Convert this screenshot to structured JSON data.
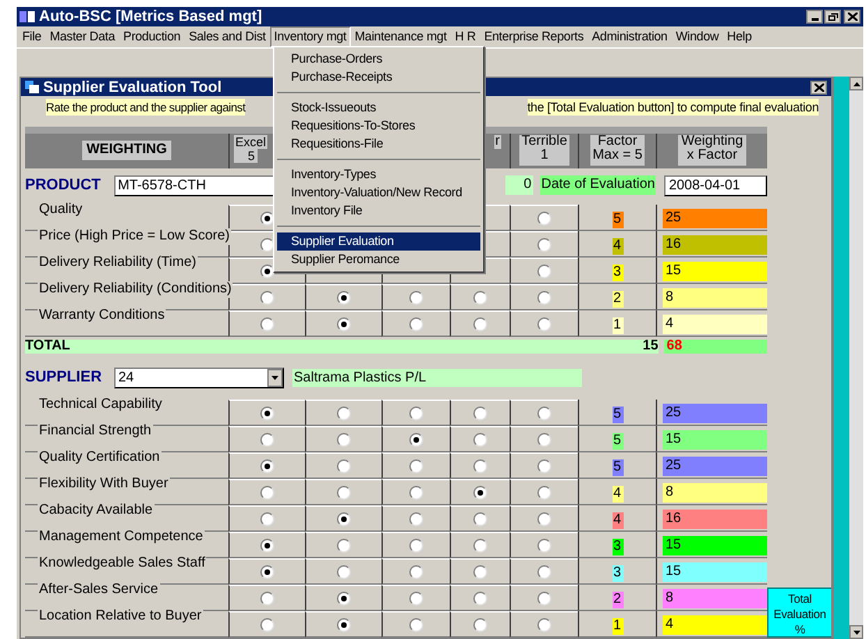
{
  "window": {
    "title": "Auto-BSC [Metrics Based mgt]"
  },
  "menu": [
    {
      "label": "File",
      "selected": false
    },
    {
      "label": "Master Data",
      "selected": false
    },
    {
      "label": "Production",
      "selected": false
    },
    {
      "label": "Sales and Dist",
      "selected": false
    },
    {
      "label": "Inventory mgt",
      "selected": true
    },
    {
      "label": "Maintenance mgt",
      "selected": false
    },
    {
      "label": "H R",
      "selected": false
    },
    {
      "label": "Enterprise Reports",
      "selected": false
    },
    {
      "label": "Administration",
      "selected": false
    },
    {
      "label": "Window",
      "selected": false
    },
    {
      "label": "Help",
      "selected": false
    }
  ],
  "dropdown": {
    "sections": [
      {
        "items": [
          {
            "label": "Purchase-Orders",
            "selected": false
          },
          {
            "label": "Purchase-Receipts",
            "selected": false
          }
        ]
      },
      {
        "items": [
          {
            "label": "Stock-Issueouts",
            "selected": false
          },
          {
            "label": "Requesitions-To-Stores",
            "selected": false
          },
          {
            "label": "Requesitions-File",
            "selected": false
          }
        ]
      },
      {
        "items": [
          {
            "label": "Inventory-Types",
            "selected": false
          },
          {
            "label": "Inventory-Valuation/New Record",
            "selected": false
          },
          {
            "label": "Inventory File",
            "selected": false
          }
        ]
      },
      {
        "items": [
          {
            "label": "Supplier Evaluation",
            "selected": true
          },
          {
            "label": "Supplier Peromance",
            "selected": false
          }
        ]
      }
    ]
  },
  "tool": {
    "title": "Supplier Evaluation Tool",
    "instruction_left": "Rate the product and the supplier against",
    "instruction_right": "the [Total Evaluation button] to compute final evaluation"
  },
  "header": {
    "weighting_button": "WEIGHTING",
    "excellent": {
      "label": "Excel",
      "score": "5"
    },
    "column_4": "r",
    "terrible": {
      "label": "Terrible",
      "score": "1"
    },
    "factor": [
      "Factor",
      "Max = 5"
    ],
    "weighting_x_factor": [
      "Weighting",
      "x Factor"
    ]
  },
  "product": {
    "label": "PRODUCT",
    "value": "MT-6578-CTH",
    "name": "0",
    "date_label": "Date of Evaluation",
    "date": "2008-04-01"
  },
  "product_criteria": [
    {
      "name": "Quality",
      "choices": [
        {
          "selected": true
        },
        {
          "selected": false
        }
      ],
      "factor": "5",
      "weight": "25",
      "color": "#ff8000"
    },
    {
      "name": "Price (High Price = Low Score)",
      "choices": [
        {
          "selected": false
        },
        {
          "selected": false
        }
      ],
      "factor": "4",
      "weight": "16",
      "color": "#c0c000"
    },
    {
      "name": "Delivery Reliability (Time)",
      "choices": [
        {
          "selected": true
        },
        {
          "selected": false
        }
      ],
      "factor": "3",
      "weight": "15",
      "color": "#ffff00"
    },
    {
      "name": "Delivery Reliability (Conditions)",
      "choices": [
        {
          "selected": false
        },
        {
          "selected": true
        },
        {
          "selected": false
        },
        {
          "selected": false
        },
        {
          "selected": false
        }
      ],
      "factor": "2",
      "weight": "8",
      "color": "#ffff80"
    },
    {
      "name": "Warranty Conditions",
      "choices": [
        {
          "selected": false
        },
        {
          "selected": true
        },
        {
          "selected": false
        },
        {
          "selected": false
        },
        {
          "selected": false
        }
      ],
      "factor": "1",
      "weight": "4",
      "color": "#ffffc0"
    }
  ],
  "total": {
    "label": "TOTAL",
    "factor": "15",
    "weight": "68"
  },
  "supplier": {
    "label": "SUPPLIER",
    "value": "24",
    "name": "Saltrama Plastics P/L"
  },
  "supplier_criteria": [
    {
      "name": "Technical Capability",
      "choices": [
        {
          "selected": true
        },
        {
          "selected": false
        },
        {
          "selected": false
        },
        {
          "selected": false
        },
        {
          "selected": false
        }
      ],
      "factor": "5",
      "weight": "25",
      "color": "#8080ff"
    },
    {
      "name": "Financial Strength",
      "choices": [
        {
          "selected": false
        },
        {
          "selected": false
        },
        {
          "selected": true
        },
        {
          "selected": false
        },
        {
          "selected": false
        }
      ],
      "factor": "5",
      "weight": "15",
      "color": "#80ff80"
    },
    {
      "name": "Quality Certification",
      "choices": [
        {
          "selected": true
        },
        {
          "selected": false
        },
        {
          "selected": false
        },
        {
          "selected": false
        },
        {
          "selected": false
        }
      ],
      "factor": "5",
      "weight": "25",
      "color": "#8080ff"
    },
    {
      "name": "Flexibility With Buyer",
      "choices": [
        {
          "selected": false
        },
        {
          "selected": false
        },
        {
          "selected": false
        },
        {
          "selected": true
        },
        {
          "selected": false
        }
      ],
      "factor": "4",
      "weight": "8",
      "color": "#ffff80"
    },
    {
      "name": "Cabacity Available",
      "choices": [
        {
          "selected": false
        },
        {
          "selected": true
        },
        {
          "selected": false
        },
        {
          "selected": false
        },
        {
          "selected": false
        }
      ],
      "factor": "4",
      "weight": "16",
      "color": "#ff8080"
    },
    {
      "name": "Management Competence",
      "choices": [
        {
          "selected": true
        },
        {
          "selected": false
        },
        {
          "selected": false
        },
        {
          "selected": false
        },
        {
          "selected": false
        }
      ],
      "factor": "3",
      "weight": "15",
      "color": "#00ff00"
    },
    {
      "name": "Knowledgeable Sales Staff",
      "choices": [
        {
          "selected": true
        },
        {
          "selected": false
        },
        {
          "selected": false
        },
        {
          "selected": false
        },
        {
          "selected": false
        }
      ],
      "factor": "3",
      "weight": "15",
      "color": "#80ffff"
    },
    {
      "name": "After-Sales Service",
      "choices": [
        {
          "selected": false
        },
        {
          "selected": true
        },
        {
          "selected": false
        },
        {
          "selected": false
        },
        {
          "selected": false
        }
      ],
      "factor": "2",
      "weight": "8",
      "color": "#ff80ff"
    },
    {
      "name": "Location Relative to Buyer",
      "choices": [
        {
          "selected": false
        },
        {
          "selected": true
        },
        {
          "selected": false
        },
        {
          "selected": false
        },
        {
          "selected": false
        }
      ],
      "factor": "1",
      "weight": "4",
      "color": "#ffff00"
    }
  ],
  "total_evaluation_button": "Total Evaluation %"
}
